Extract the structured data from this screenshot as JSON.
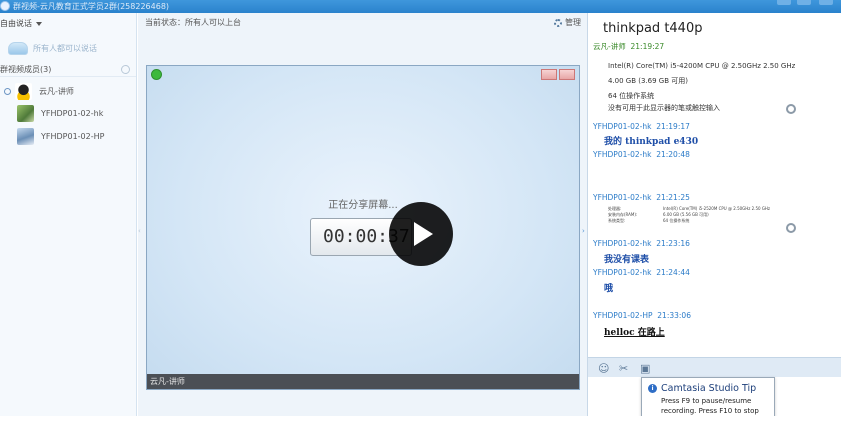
{
  "window": {
    "title": "群视频-云凡教育正式学员2群(258226468)"
  },
  "sidebar": {
    "free_talk_label": "自由说话",
    "all_speak_label": "所有人都可以说话",
    "members_header": "群视频成员(3)",
    "members": [
      {
        "name": "云凡-讲师",
        "avatar": "qq-penguin"
      },
      {
        "name": "YFHDP01-02-hk",
        "avatar": "photo"
      },
      {
        "name": "YFHDP01-02-HP",
        "avatar": "photo"
      }
    ]
  },
  "center": {
    "status_text": "当前状态：所有人可以上台",
    "manage_label": "管理",
    "sharing_text": "正在分享屏幕...",
    "timer_text": "00:00:37",
    "stage_owner": "云凡-讲师"
  },
  "chat": {
    "title": "thinkpad  t440p",
    "messages": [
      {
        "sender": "云凡-讲师",
        "time": "21:19:27"
      },
      {
        "sender": "YFHDP01-02-hk",
        "time": "21:19:17",
        "text": "我的 thinkpad e430"
      },
      {
        "sender": "YFHDP01-02-hk",
        "time": "21:20:48"
      },
      {
        "sender": "YFHDP01-02-hk",
        "time": "21:21:25"
      },
      {
        "sender": "YFHDP01-02-hk",
        "time": "21:23:16",
        "text": "我没有课表"
      },
      {
        "sender": "YFHDP01-02-hk",
        "time": "21:24:44",
        "text": "哦"
      },
      {
        "sender": "YFHDP01-02-HP",
        "time": "21:33:06",
        "text": "helloc 在路上"
      }
    ],
    "spec_large": [
      "Intel(R) Core(TM) i5-4200M CPU @ 2.50GHz  2.50 GHz",
      "4.00 GB (3.69 GB 可用)",
      "64 位操作系统",
      "没有可用于此显示器的笔或触控输入"
    ],
    "spec_small": [
      {
        "k": "处理器:",
        "v": "Intel(R) Core(TM) i5-2520M CPU @ 2.50GHz  2.50 GHz"
      },
      {
        "k": "安装内存(RAM):",
        "v": "6.00 GB (5.56 GB 可用)"
      },
      {
        "k": "系统类型:",
        "v": "64 位操作系统"
      }
    ]
  },
  "toolbar_icons": [
    "smile-icon",
    "scissors-icon",
    "image-icon"
  ],
  "tip": {
    "title": "Camtasia Studio Tip",
    "body": "Press F9 to pause/resume recording.  Press F10 to stop"
  },
  "colors": {
    "titlebar": "#2a82cc",
    "link_blue": "#2b7bc8",
    "live_green": "#3cb93c"
  }
}
